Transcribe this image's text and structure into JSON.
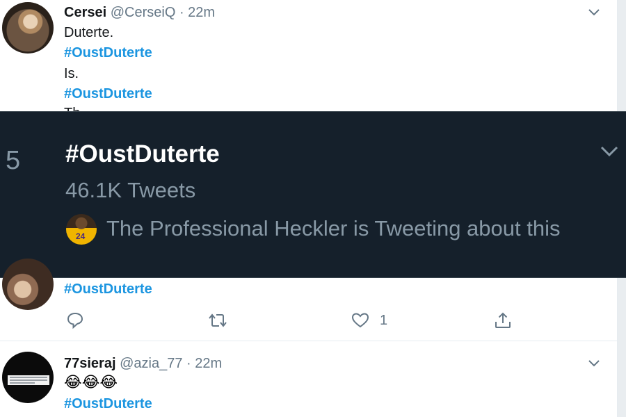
{
  "tweet1": {
    "name": "Cersei",
    "handle": "@CerseiQ",
    "separator": "·",
    "time": "22m",
    "lines": [
      "Duterte.",
      "#OustDuterte",
      "Is.",
      "#OustDuterte",
      "Th"
    ]
  },
  "trend": {
    "rank": "5",
    "hashtag": "#OustDuterte",
    "tweet_count": "46.1K Tweets",
    "context": "The Professional Heckler is Tweeting about this",
    "avatar_text": "24"
  },
  "tweet2": {
    "hashtag": "#OustDuterte",
    "like_count": "1"
  },
  "tweet3": {
    "name": "77sieraj",
    "handle": "@azia_77",
    "separator": "·",
    "time": "22m",
    "emoji": "😂😂😂",
    "hashtag": "#OustDuterte"
  },
  "icons": {
    "reply": "reply-icon",
    "retweet": "retweet-icon",
    "like": "heart-icon",
    "share": "share-icon",
    "menu": "chevron-down-icon"
  },
  "colors": {
    "hashtag": "#1b95e0",
    "muted": "#657786",
    "dark_bg": "#15202b",
    "dark_text": "#8899a6"
  }
}
